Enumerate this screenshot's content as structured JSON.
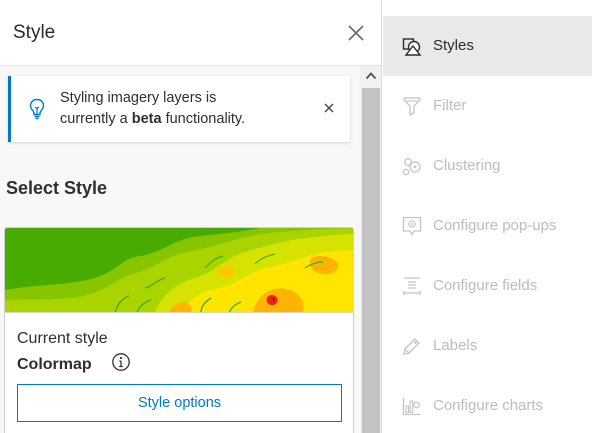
{
  "panel": {
    "title": "Style",
    "close_icon": "close-icon"
  },
  "notice": {
    "icon": "lightbulb-icon",
    "line1": "Styling imagery layers is",
    "line2_pre": "currently a ",
    "line2_bold": "beta",
    "line2_post": " functionality.",
    "close_icon": "close-icon"
  },
  "select_style": {
    "heading": "Select Style"
  },
  "card": {
    "current_label": "Current style",
    "style_name": "Colormap",
    "info_icon": "info-icon",
    "options_button": "Style options"
  },
  "menu": {
    "items": [
      {
        "label": "Styles",
        "icon": "styles-icon",
        "state": "active"
      },
      {
        "label": "Filter",
        "icon": "filter-icon",
        "state": "disabled"
      },
      {
        "label": "Clustering",
        "icon": "clustering-icon",
        "state": "disabled"
      },
      {
        "label": "Configure pop-ups",
        "icon": "popup-icon",
        "state": "disabled"
      },
      {
        "label": "Configure fields",
        "icon": "fields-icon",
        "state": "disabled"
      },
      {
        "label": "Labels",
        "icon": "label-icon",
        "state": "disabled"
      },
      {
        "label": "Configure charts",
        "icon": "charts-icon",
        "state": "disabled"
      }
    ]
  },
  "colors": {
    "accent": "#007ac2",
    "active_bg": "#e9e9e9",
    "disabled_text": "#bdbdbd",
    "colormap_green": "#48ab00",
    "colormap_lime": "#9fd000",
    "colormap_yellow": "#ffe500",
    "colormap_orange": "#ffb400",
    "colormap_red": "#e8231b"
  }
}
